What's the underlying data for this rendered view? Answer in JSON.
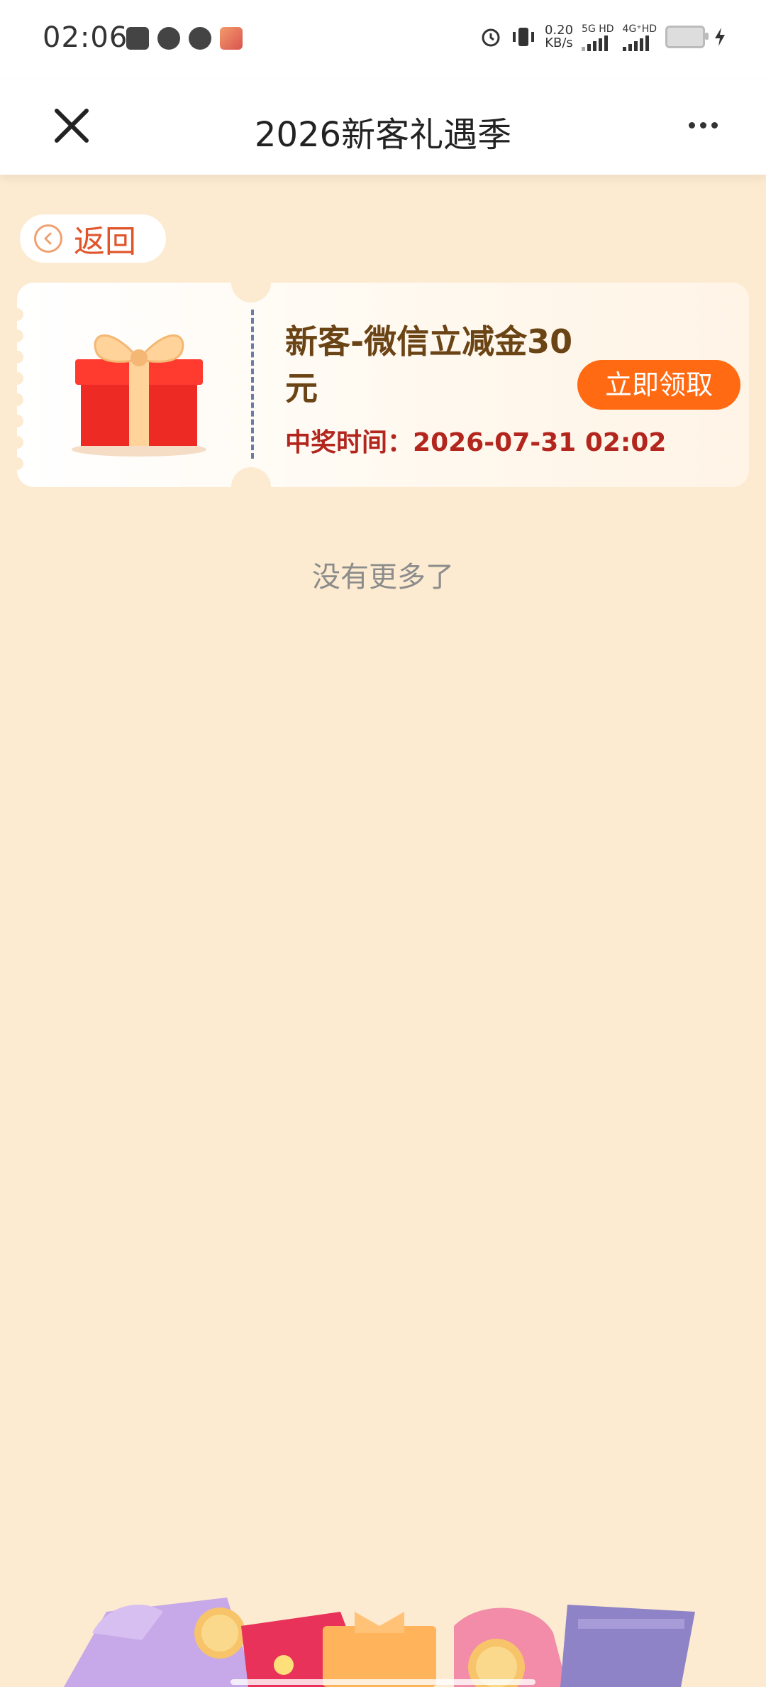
{
  "status_bar": {
    "time": "02:06",
    "net_speed_value": "0.20",
    "net_speed_unit": "KB/s",
    "sim1_label": "5G HD",
    "sim2_label": "4G⁺HD",
    "icons": [
      "notification-icon",
      "wechat-icon",
      "message-icon",
      "app-icon",
      "alarm-icon",
      "vibrate-icon",
      "battery-icon",
      "charging-icon"
    ]
  },
  "title_bar": {
    "title": "2026新客礼遇季",
    "close_icon": "close-icon",
    "more_icon": "more-icon"
  },
  "back": {
    "label": "返回",
    "icon": "chevron-left-icon"
  },
  "coupon": {
    "title": "新客-微信立减金30元",
    "time_label": "中奖时间：",
    "time_value": "2026-07-31 02:02",
    "claim_label": "立即领取",
    "image_icon": "gift-box-icon"
  },
  "list_footer": "没有更多了",
  "colors": {
    "background": "#fcebd0",
    "accent": "#ff6a13",
    "title_text": "#6b4416",
    "time_text": "#b3261e",
    "back_text": "#e0542a"
  }
}
